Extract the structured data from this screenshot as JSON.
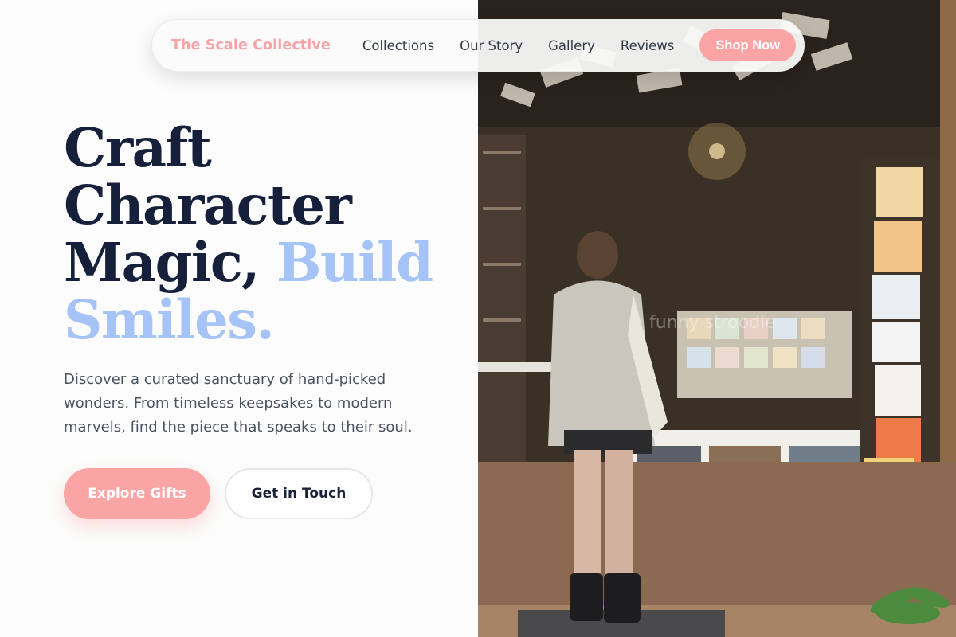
{
  "nav": {
    "brand": "The Scale Collective",
    "links": [
      "Collections",
      "Our Story",
      "Gallery",
      "Reviews"
    ],
    "cta": "Shop Now"
  },
  "hero": {
    "headline_main": "Craft Character Magic, ",
    "headline_accent": "Build Smiles.",
    "description": "Discover a curated sanctuary of hand-picked wonders. From timeless keepsakes to modern marvels, find the piece that speaks to their soul.",
    "primary_button": "Explore Gifts",
    "secondary_button": "Get in Touch"
  },
  "image": {
    "watermark": "funny stroodle"
  },
  "colors": {
    "brand_pink": "#fba4a6",
    "accent_blue": "#a5c3f7",
    "heading_navy": "#16203a"
  }
}
